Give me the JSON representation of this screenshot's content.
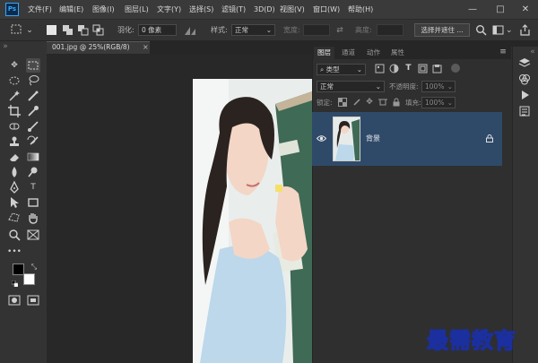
{
  "app": {
    "logo": "Ps"
  },
  "menu": [
    "文件(F)",
    "编辑(E)",
    "图像(I)",
    "图层(L)",
    "文字(Y)",
    "选择(S)",
    "滤镜(T)",
    "3D(D)",
    "视图(V)",
    "窗口(W)",
    "帮助(H)"
  ],
  "window_controls": {
    "minimize": "—",
    "maximize": "□",
    "close": "✕"
  },
  "options": {
    "feather_label": "羽化:",
    "feather_value": "0 像素",
    "style_label": "样式:",
    "style_value": "正常",
    "width_label": "宽度:",
    "height_label": "高度:",
    "select_mask_label": "选择并遮住 ..."
  },
  "document": {
    "tab_label": "001.jpg @ 25%(RGB/8)",
    "close_glyph": "×"
  },
  "panel": {
    "tabs": [
      "图层",
      "通道",
      "动作",
      "属性"
    ],
    "filter_label": "类型",
    "blend_mode": "正常",
    "opacity_label": "不透明度:",
    "opacity_value": "100%",
    "lock_label": "锁定:",
    "fill_label": "填充:",
    "fill_value": "100%"
  },
  "layers": [
    {
      "name": "背景",
      "visible": true,
      "locked": true
    }
  ],
  "watermark": "最需教育",
  "colors": {
    "accent": "#31a8ff",
    "layer_selected": "#2f4a69",
    "foreground": "#000000",
    "background": "#ffffff"
  }
}
